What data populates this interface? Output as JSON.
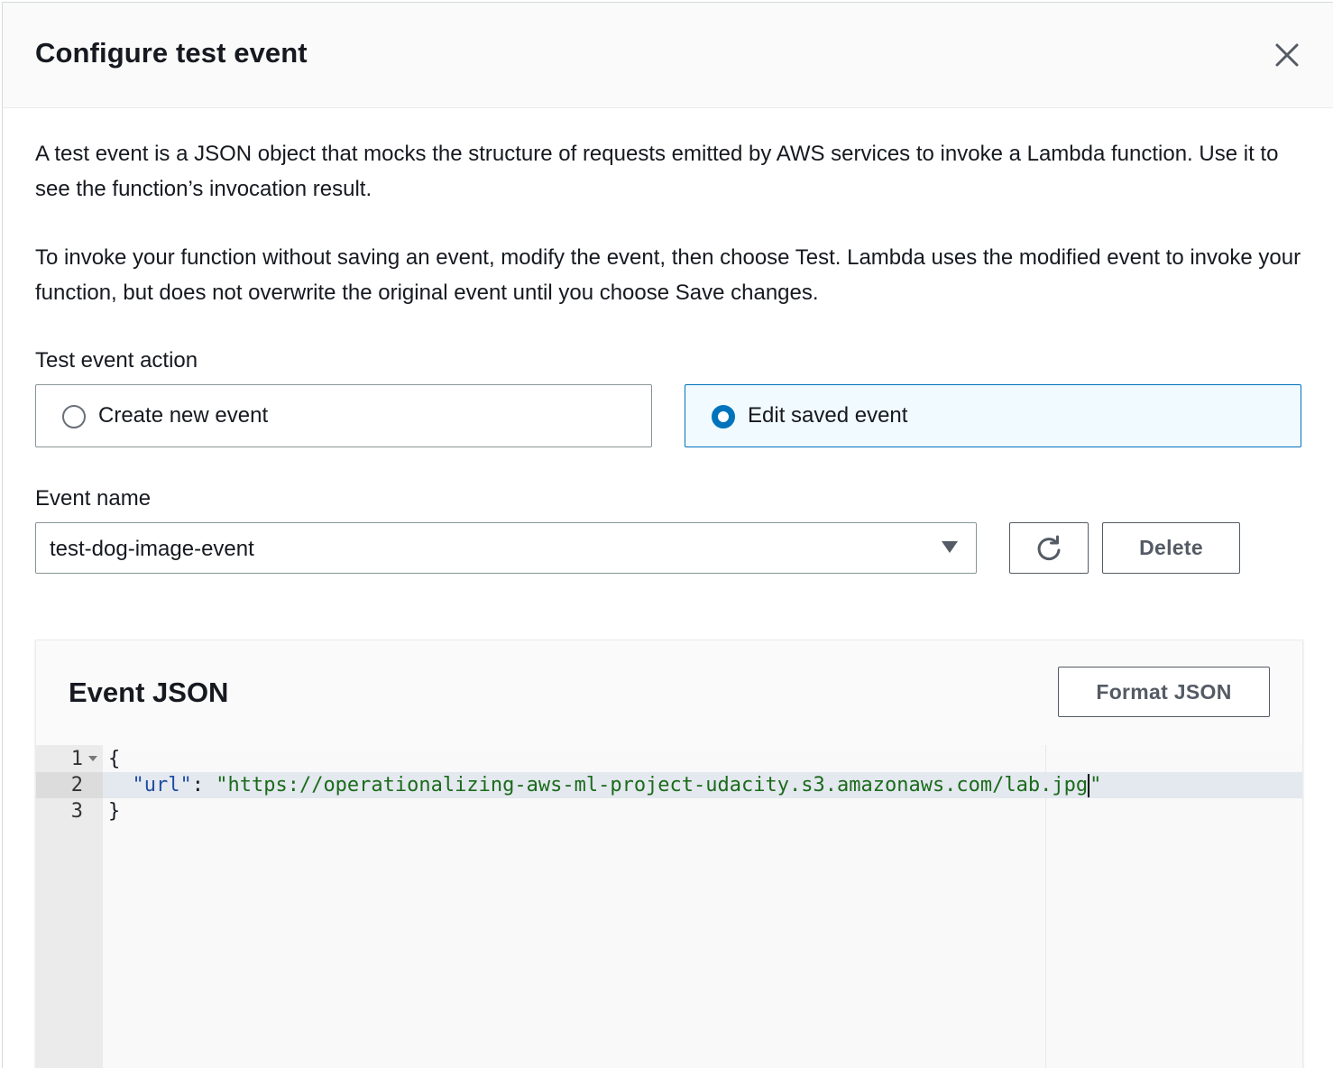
{
  "modal": {
    "title": "Configure test event",
    "description": "A test event is a JSON object that mocks the structure of requests emitted by AWS services to invoke a Lambda function. Use it to see the function’s invocation result.",
    "instructions": "To invoke your function without saving an event, modify the event, then choose Test. Lambda uses the modified event to invoke your function, but does not overwrite the original event until you choose Save changes."
  },
  "test_event_action": {
    "label": "Test event action",
    "options": [
      {
        "label": "Create new event",
        "selected": false
      },
      {
        "label": "Edit saved event",
        "selected": true
      }
    ]
  },
  "event_name": {
    "label": "Event name",
    "value": "test-dog-image-event",
    "delete_label": "Delete"
  },
  "event_json": {
    "title": "Event JSON",
    "format_label": "Format JSON",
    "line_numbers": [
      "1",
      "2",
      "3"
    ],
    "lines": {
      "open": "{",
      "key": "\"url\"",
      "colon": ": ",
      "value": "\"https://operationalizing-aws-ml-project-udacity.s3.amazonaws.com/lab.jpg",
      "value_end": "\"",
      "close": "}"
    }
  },
  "colors": {
    "accent": "#0073bb",
    "selected_bg": "#f1faff",
    "text": "#16191f",
    "button_text": "#545b64"
  },
  "icons": {
    "close": "close-icon",
    "refresh": "refresh-icon",
    "caret": "caret-down-icon"
  }
}
